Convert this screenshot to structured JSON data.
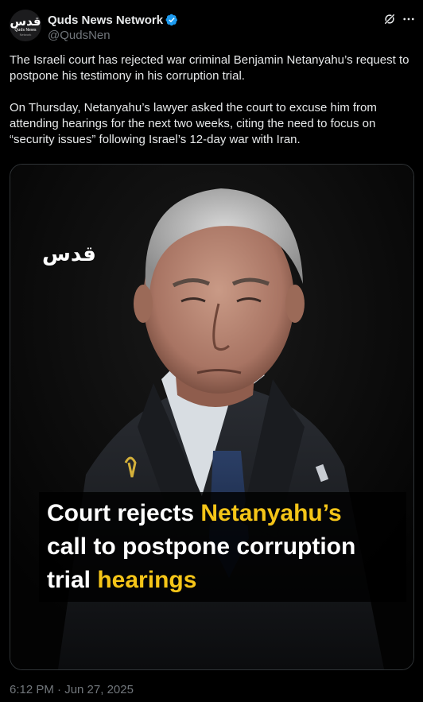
{
  "author": {
    "display_name": "Quds News Network",
    "handle": "@QudsNen",
    "avatar_logo_ar": "قدس",
    "avatar_logo_en": "Quds News",
    "avatar_logo_en2": "Network",
    "verified": true,
    "verified_color": "#1d9bf0"
  },
  "actions": {
    "grok_icon": "grok-icon",
    "more_icon": "more-icon"
  },
  "text": {
    "paragraph_1": "The Israeli court has rejected war criminal Benjamin Netanyahu’s request to postpone his testimony in his corruption trial.",
    "paragraph_2": "On Thursday, Netanyahu’s lawyer asked the court to excuse him from attending hearings for the next two weeks, citing the need to focus on “security issues” following Israel’s 12-day war with Iran."
  },
  "media": {
    "watermark": "قدس",
    "caption": {
      "line1_a": "Court rejects ",
      "line1_b": "Netanyahu’s",
      "line2": "call to postpone corruption",
      "line3_a": "trial ",
      "line3_b": "hearings"
    },
    "highlight_color": "#f5c518"
  },
  "timestamp": "6:12 PM · Jun 27, 2025"
}
